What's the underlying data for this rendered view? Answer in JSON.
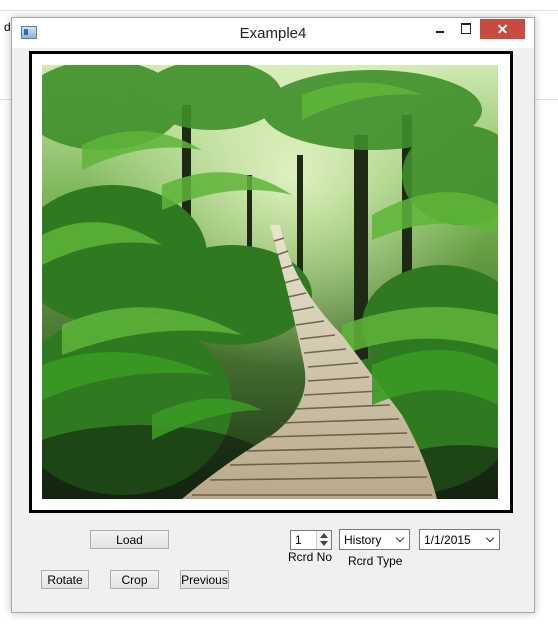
{
  "background_app": {
    "visible_char": "d"
  },
  "window": {
    "title": "Example4",
    "controls": {
      "minimize": "minimize",
      "maximize": "maximize",
      "close": "close"
    }
  },
  "image": {
    "subject": "rainforest boardwalk"
  },
  "buttons": {
    "load": "Load",
    "rotate": "Rotate",
    "crop": "Crop",
    "previous": "Previous"
  },
  "record": {
    "number_value": "1",
    "number_label": "Rcrd No",
    "type_value": "History",
    "type_label": "Rcrd Type",
    "date_value": "1/1/2015"
  },
  "colors": {
    "close_button": "#c74b3e",
    "window_bg": "#f0f0f0"
  }
}
